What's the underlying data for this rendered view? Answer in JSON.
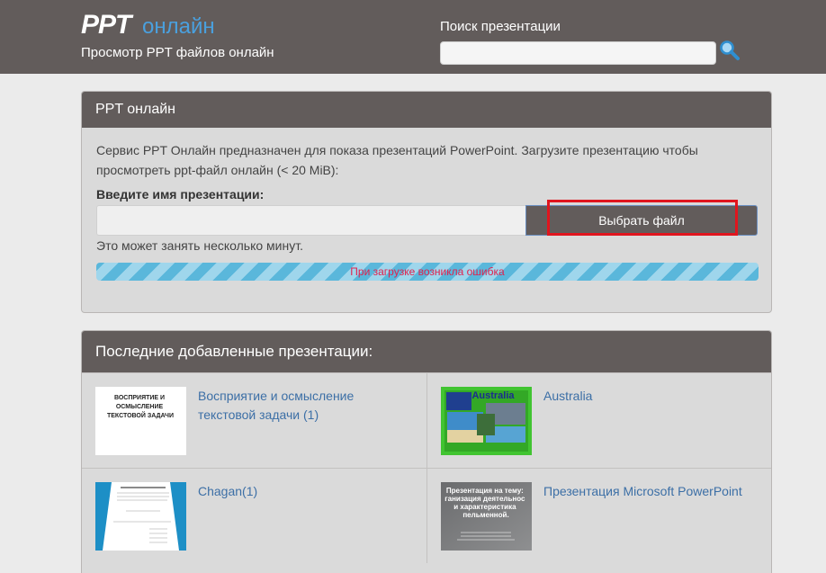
{
  "header": {
    "logo_text": "PPT",
    "logo_word": "онлайн",
    "tagline": "Просмотр PPT файлов онлайн",
    "search_label": "Поиск презентации",
    "search_placeholder": "",
    "search_value": ""
  },
  "upload_panel": {
    "title": "PPT онлайн",
    "description": "Сервис PPT Онлайн предназначен для показа презентаций PowerPoint. Загрузите презентацию чтобы просмотреть ppt-файл онлайн (< 20 MiB):",
    "field_label": "Введите имя презентации:",
    "file_value": "",
    "button_label": "Выбрать файл",
    "hint": "Это может занять несколько минут.",
    "progress_text": "При загрузке возникла ошибка",
    "progress_fraction": 1.0
  },
  "recent_panel": {
    "title": "Последние добавленные презентации:",
    "items": [
      {
        "title": "Восприятие и осмысление текстовой задачи (1)",
        "thumb_text": "ВОСПРИЯТИЕ И ОСМЫСЛЕНИЕ ТЕКСТОВОЙ ЗАДАЧИ"
      },
      {
        "title": "Australia",
        "thumb_text": "Australia"
      },
      {
        "title": "Chagan(1)",
        "thumb_text": ""
      },
      {
        "title": "Презентация Microsoft PowerPoint",
        "thumb_text": "Презентация на тему: организация деятельности и характеристика пельменной."
      }
    ]
  },
  "colors": {
    "header_bg": "#625c5b",
    "accent": "#4aa0de",
    "link": "#3c6fa6",
    "error": "#e0224e",
    "highlight": "#e0151e"
  }
}
